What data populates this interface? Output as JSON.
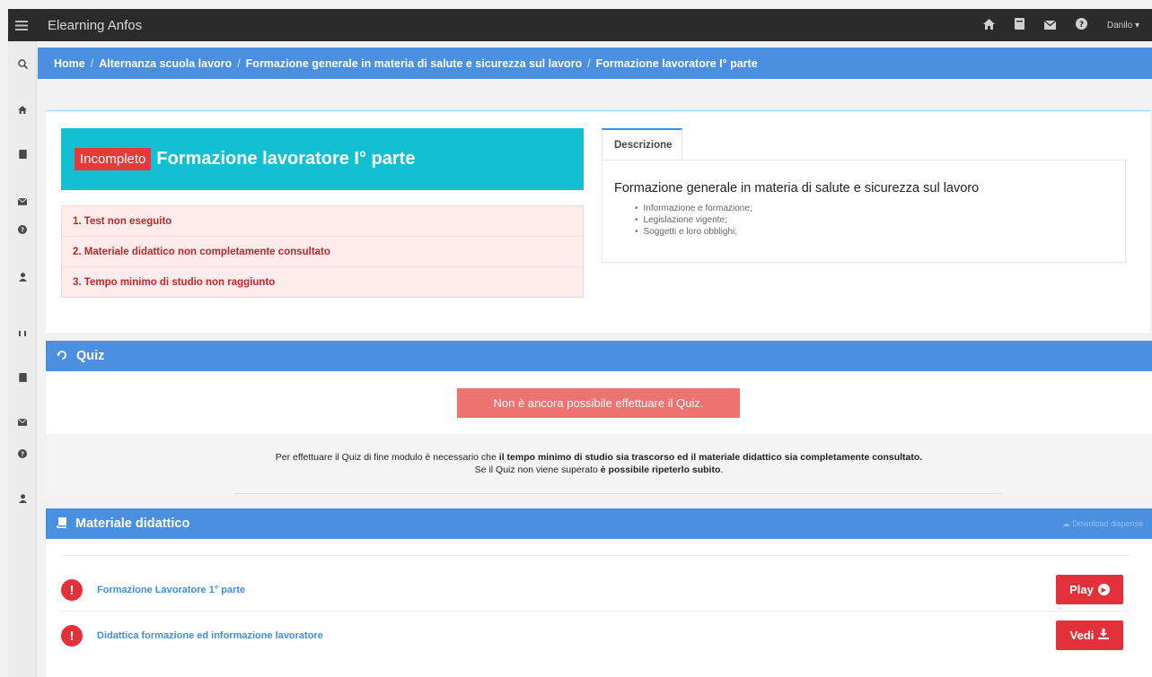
{
  "app": {
    "title": "Elearning Anfos"
  },
  "topbar": {
    "user_label": "Danilo ▾"
  },
  "breadcrumb": [
    "Home",
    "Alternanza scuola lavoro",
    "Formazione generale in materia di salute e sicurezza sul lavoro",
    "Formazione lavoratore I° parte"
  ],
  "module": {
    "status_badge": "Incompleto",
    "title": "Formazione lavoratore I° parte",
    "requirements": [
      "1. Test non eseguito",
      "2. Materiale didattico non completamente consultato",
      "3. Tempo minimo di studio non raggiunto"
    ]
  },
  "description": {
    "tab_label": "Descrizione",
    "heading": "Formazione generale in materia di salute e sicurezza sul lavoro",
    "items": [
      "Informazione e formazione;",
      "Legislazione vigente;",
      "Soggetti e loro obblighi;"
    ]
  },
  "quiz": {
    "header": "Quiz",
    "disabled_button": "Non è ancora possibile effettuare il Quiz.",
    "note_prefix": "Per effettuare il Quiz di fine modulo è necessario che ",
    "note_bold": "il tempo minimo di studio sia trascorso ed il materiale didattico sia completamente consultato.",
    "note2_prefix": "Se il Quiz non viene superato ",
    "note2_bold": "è possibile ripeterlo subito",
    "note2_suffix": "."
  },
  "materials": {
    "header": "Materiale didattico",
    "download_label": "Download dispense",
    "items": [
      {
        "title": "Formazione Lavoratore 1° parte",
        "action": "Play"
      },
      {
        "title": "Didattica formazione ed informazione lavoratore",
        "action": "Vedi"
      }
    ]
  },
  "colors": {
    "primary": "#4a8fe0",
    "title_box": "#13c0d1",
    "danger": "#e2313a",
    "topbar": "#2b2b2b"
  }
}
